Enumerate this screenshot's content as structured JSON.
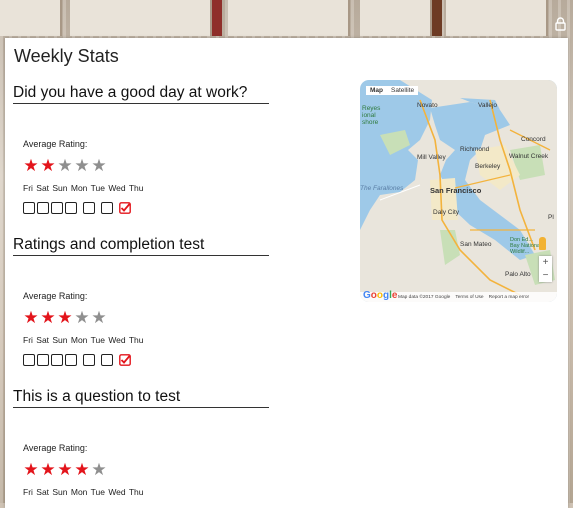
{
  "page": {
    "title": "Weekly Stats"
  },
  "questions": [
    {
      "title": "Did you have a good day at work?",
      "avg_label": "Average Rating:",
      "rating": 2,
      "max": 5,
      "days": "Fri Sat Sun Mon Tue Wed Thu",
      "checked": [
        false,
        false,
        false,
        false,
        false,
        false,
        true
      ]
    },
    {
      "title": "Ratings and completion test",
      "avg_label": "Average Rating:",
      "rating": 3,
      "max": 5,
      "days": "Fri Sat Sun Mon Tue Wed Thu",
      "checked": [
        false,
        false,
        false,
        false,
        false,
        false,
        true
      ]
    },
    {
      "title": "This is a question to test",
      "avg_label": "Average Rating:",
      "rating": 4,
      "max": 5,
      "days": "Fri Sat Sun Mon Tue Wed Thu",
      "checked": []
    }
  ],
  "map": {
    "tabs": [
      "Map",
      "Satellite"
    ],
    "labels": {
      "novato": "Novato",
      "vallejo": "Vallejo",
      "concord": "Concord",
      "richmond": "Richmond",
      "mill_valley": "Mill Valley",
      "walnut_creek": "Walnut Creek",
      "berkeley": "Berkeley",
      "san_francisco": "San Francisco",
      "daly_city": "Daly City",
      "san_mateo": "San Mateo",
      "palo_alto": "Palo Alto",
      "reyes": "Reyes",
      "ional": "ional",
      "shore": "shore",
      "farallones": "The Farallones",
      "bay_refuge": "Don Ed...\nBay National\nWildlif...",
      "pl": "Pl"
    },
    "footer": [
      "Map data ©2017 Google",
      "Terms of Use",
      "Report a map error"
    ],
    "logo": "Google",
    "zoom_in": "+",
    "zoom_out": "−"
  },
  "colors": {
    "star_on": "#e3141b",
    "star_off": "#8f8f8f",
    "check": "#e3141b"
  }
}
